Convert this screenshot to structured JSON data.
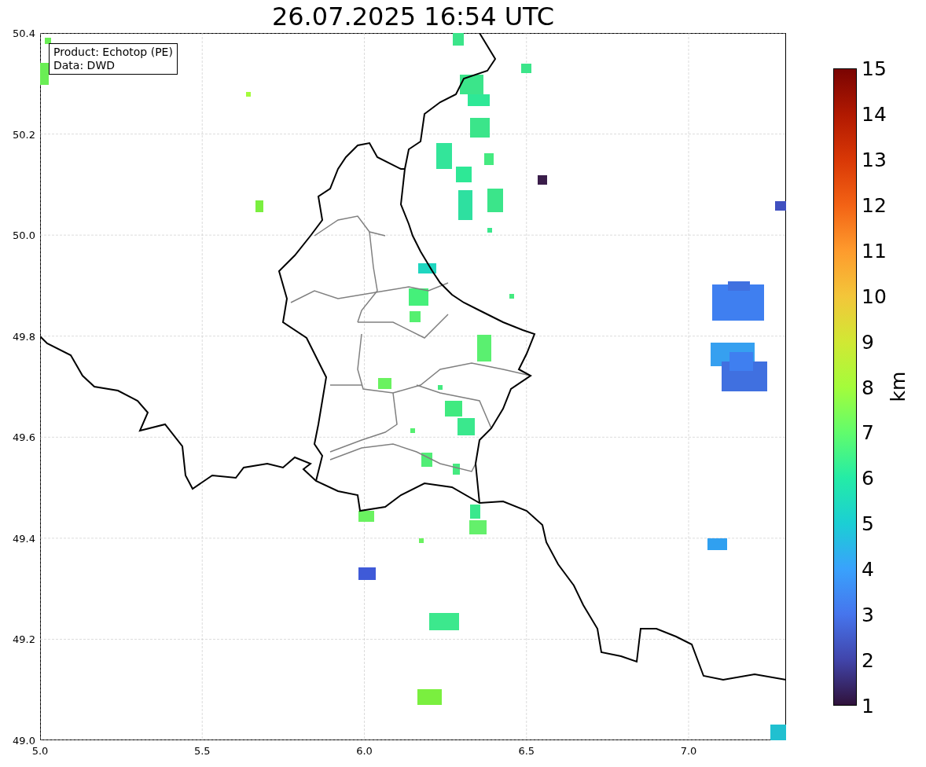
{
  "title": "26.07.2025 16:54 UTC",
  "legend": {
    "lines": [
      "Product: Echotop (PE)",
      "Data: DWD"
    ]
  },
  "x_ticks": [
    "5.0",
    "5.5",
    "6.0",
    "6.5",
    "7.0"
  ],
  "y_ticks": [
    "50.4",
    "50.2",
    "50.0",
    "49.8",
    "49.6",
    "49.4",
    "49.2",
    "49.0"
  ],
  "colorbar": {
    "ticks": [
      "15",
      "14",
      "13",
      "12",
      "11",
      "10",
      "9",
      "8",
      "7",
      "6",
      "5",
      "4",
      "3",
      "2",
      "1"
    ],
    "label": "km"
  }
}
